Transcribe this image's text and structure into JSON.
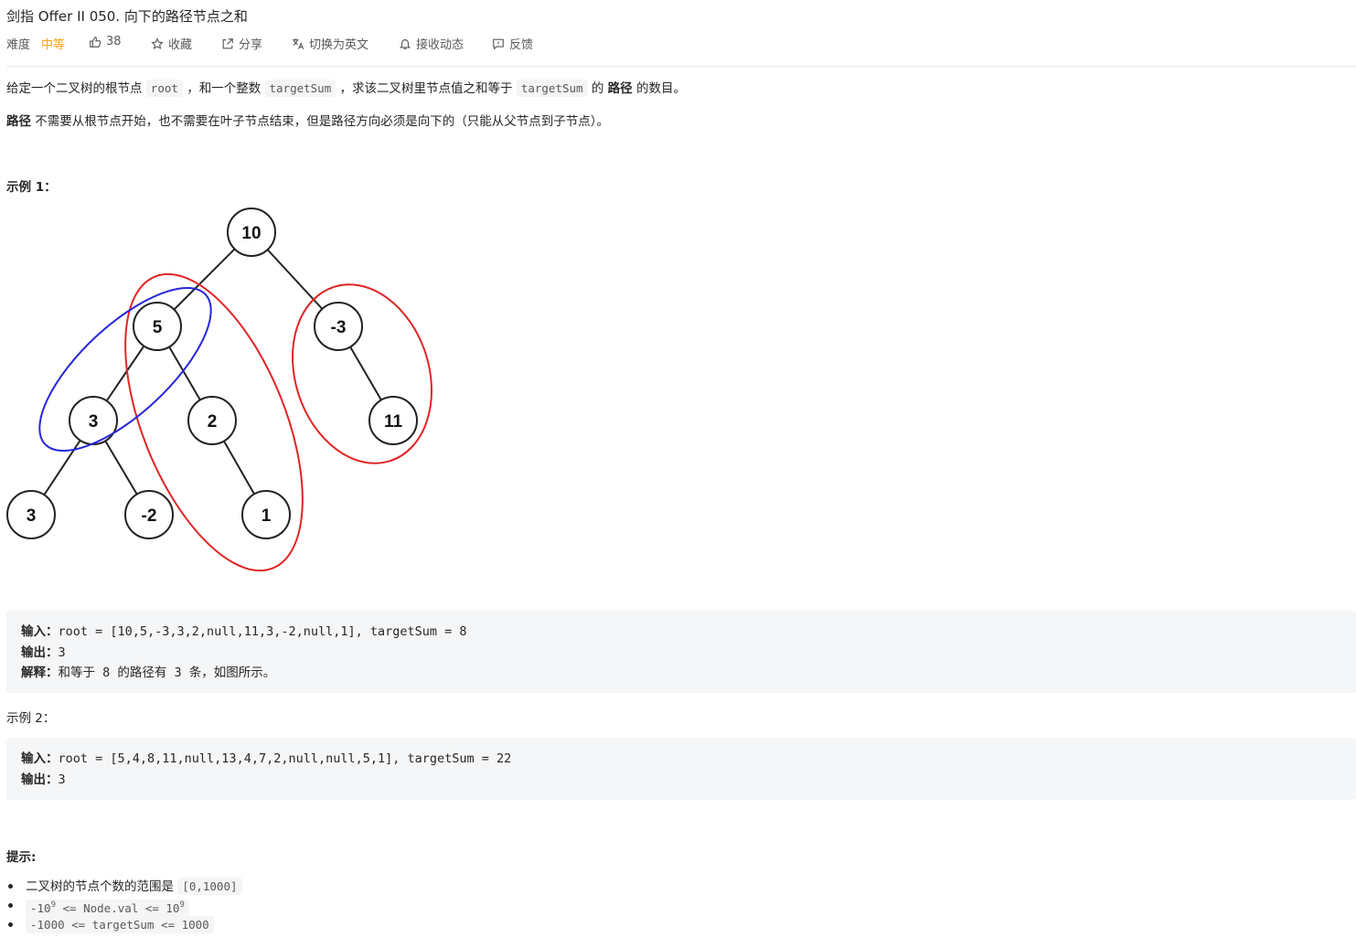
{
  "title": "剑指 Offer II 050. 向下的路径节点之和",
  "toolbar": {
    "difficulty_label": "难度",
    "difficulty_value": "中等",
    "likes": "38",
    "favorite": "收藏",
    "share": "分享",
    "translate": "切换为英文",
    "notify": "接收动态",
    "feedback": "反馈"
  },
  "description": {
    "p1_a": "给定一个二叉树的根节点",
    "p1_code1": "root",
    "p1_b": "，和一个整数",
    "p1_code2": "targetSum",
    "p1_c": "，求该二叉树里节点值之和等于",
    "p1_code3": "targetSum",
    "p1_d": "的",
    "p1_bold": "路径",
    "p1_e": "的数目。",
    "p2_bold": "路径",
    "p2_text": "不需要从根节点开始，也不需要在叶子节点结束，但是路径方向必须是向下的（只能从父节点到子节点）。"
  },
  "example1": {
    "label": "示例 1：",
    "tree_nodes": [
      "10",
      "5",
      "-3",
      "3",
      "2",
      "11",
      "3",
      "-2",
      "1"
    ],
    "input_label": "输入：",
    "input_value": "root = [10,5,-3,3,2,null,11,3,-2,null,1], targetSum = 8",
    "output_label": "输出：",
    "output_value": "3",
    "explain_label": "解释：",
    "explain_value": "和等于 8 的路径有 3 条，如图所示。"
  },
  "example2": {
    "label": "示例 2：",
    "input_label": "输入：",
    "input_value": "root = [5,4,8,11,null,13,4,7,2,null,null,5,1], targetSum = 22",
    "output_label": "输出：",
    "output_value": "3"
  },
  "hints": {
    "label": "提示:",
    "h1_text": "二叉树的节点个数的范围是",
    "h1_code": "[0,1000]",
    "h2_a": "-10",
    "h2_sup1": "9",
    "h2_b": " <= Node.val <= 10",
    "h2_sup2": "9",
    "h3_code": "-1000 <= targetSum <= 1000"
  },
  "colors": {
    "accent_difficulty": "#ffa116",
    "path_red": "#e02424",
    "path_blue": "#2626d9"
  }
}
